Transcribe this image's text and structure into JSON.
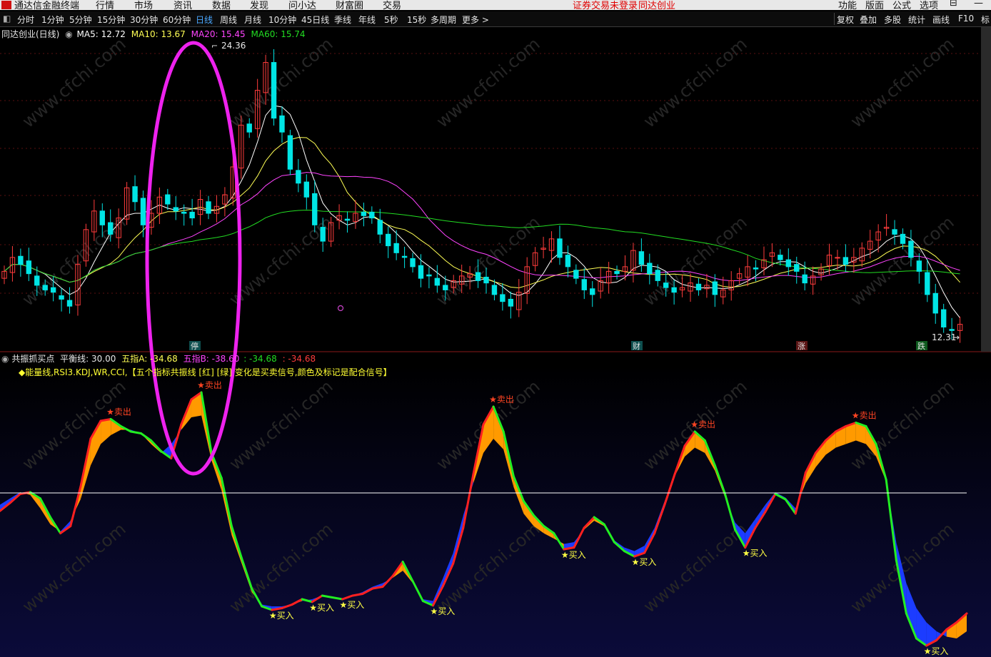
{
  "topbar": {
    "app_title": "通达信金融终端",
    "menu": [
      "行情",
      "市场",
      "资讯",
      "数据",
      "发现",
      "问小达",
      "财富圈",
      "交易"
    ],
    "warning": "证券交易未登录",
    "stock_name": "同达创业",
    "right_menu": [
      "功能",
      "版面",
      "公式",
      "选项"
    ]
  },
  "periods": [
    "分时",
    "1分钟",
    "5分钟",
    "15分钟",
    "30分钟",
    "60分钟",
    "日线",
    "周线",
    "月线",
    "10分钟",
    "45日线",
    "季线",
    "年线",
    "5秒",
    "15秒",
    "多周期",
    "更多 >"
  ],
  "active_period": "日线",
  "tools": [
    "复权",
    "叠加",
    "多股",
    "统计",
    "画线",
    "F10",
    "标"
  ],
  "main_legend": {
    "name": "同达创业(日线)",
    "ma5": "MA5: 12.72",
    "ma10": "MA10: 13.67",
    "ma20": "MA20: 15.45",
    "ma60": "MA60: 15.74"
  },
  "colors": {
    "up": "#ff3c3c",
    "down": "#00e5e5",
    "ma5": "#ffffff",
    "ma10": "#ffff55",
    "ma20": "#ff44ff",
    "ma60": "#22dd22",
    "band_up": "#ff9a00",
    "band_down": "#1c3cff",
    "highlight": "#ee22ee"
  },
  "sub_legend": {
    "name": "共振抓买点",
    "balance": "平衡线: 30.00",
    "a": "五指A: -34.68",
    "b": "五指B: -38.60",
    "c": ": -34.68",
    "d": ": -34.68",
    "desc": "◆能量线,RSI3.KDJ,WR,CCI,【五个指标共振线 [红] [绿] 变化是买卖信号,颜色及标记是配合信号】"
  },
  "chart_data": [
    {
      "type": "candlestick",
      "title": "同达创业(日线)",
      "price_max_label": "24.36",
      "price_min_label": "12.31",
      "event_labels": [
        "停",
        "财",
        "涨",
        "跌"
      ],
      "series": [
        {
          "name": "MA5",
          "value": 12.72
        },
        {
          "name": "MA10",
          "value": 13.67
        },
        {
          "name": "MA20",
          "value": 15.45
        },
        {
          "name": "MA60",
          "value": 15.74
        }
      ],
      "closes": [
        15.0,
        15.6,
        15.3,
        14.9,
        14.4,
        14.2,
        14.1,
        13.8,
        13.5,
        15.3,
        16.8,
        17.6,
        17.0,
        16.6,
        17.3,
        18.6,
        18.0,
        17.0,
        17.5,
        18.2,
        17.9,
        17.6,
        17.5,
        17.3,
        18.1,
        17.5,
        17.8,
        18.3,
        19.5,
        21.3,
        21.0,
        22.8,
        24.0,
        21.6,
        21.0,
        19.4,
        18.8,
        18.2,
        17.0,
        16.3,
        17.1,
        17.4,
        17.2,
        17.5,
        17.4,
        17.3,
        16.6,
        16.1,
        15.8,
        15.6,
        15.2,
        14.7,
        14.8,
        14.4,
        14.2,
        14.6,
        14.8,
        14.9,
        14.6,
        14.5,
        14.0,
        13.7,
        13.5,
        14.1,
        15.2,
        15.8,
        16.0,
        16.4,
        15.6,
        15.2,
        14.7,
        14.2,
        14.0,
        14.6,
        15.0,
        14.9,
        15.2,
        15.9,
        15.3,
        14.9,
        14.6,
        14.3,
        14.1,
        14.3,
        14.5,
        14.2,
        14.4,
        14.0,
        14.2,
        14.6,
        14.9,
        15.2,
        15.1,
        15.5,
        15.8,
        15.5,
        15.2,
        15.0,
        14.5,
        14.8,
        15.1,
        15.7,
        15.6,
        15.3,
        15.6,
        16.0,
        16.3,
        16.7,
        16.9,
        16.6,
        16.2,
        15.6,
        15.0,
        14.0,
        13.2,
        12.6,
        12.45,
        12.72
      ],
      "ylim": [
        12.0,
        25.0
      ]
    },
    {
      "type": "area",
      "title": "共振抓买点",
      "balance_line": 30.0,
      "annotations_buy": "买入",
      "annotations_sell": "卖出",
      "series_a": [
        -5,
        4,
        14,
        16,
        9,
        -12,
        -30,
        -22,
        22,
        76,
        96,
        98,
        90,
        84,
        82,
        74,
        62,
        54,
        92,
        120,
        128,
        60,
        32,
        -22,
        -58,
        -92,
        -112,
        -116,
        -114,
        -110,
        -104,
        -107,
        -100,
        -102,
        -104,
        -100,
        -98,
        -92,
        -90,
        -78,
        -62,
        -84,
        -106,
        -111,
        -89,
        -64,
        -24,
        36,
        92,
        112,
        84,
        34,
        6,
        -10,
        -22,
        -30,
        -48,
        -46,
        -24,
        -12,
        -20,
        -40,
        -50,
        -56,
        -52,
        -30,
        2,
        36,
        68,
        84,
        74,
        46,
        14,
        -26,
        -46,
        -24,
        -6,
        14,
        8,
        -8,
        38,
        60,
        74,
        84,
        90,
        94,
        90,
        70,
        30,
        -60,
        -120,
        -148,
        -156,
        -150,
        -138,
        -130,
        -120
      ],
      "series_b": [
        2,
        9,
        16,
        13,
        -2,
        -20,
        -28,
        -16,
        8,
        46,
        70,
        80,
        86,
        86,
        82,
        70,
        60,
        70,
        86,
        100,
        102,
        52,
        18,
        -32,
        -64,
        -96,
        -110,
        -112,
        -112,
        -110,
        -106,
        -104,
        -100,
        -102,
        -104,
        -100,
        -96,
        -90,
        -86,
        -80,
        -72,
        -86,
        -104,
        -106,
        -80,
        -52,
        -10,
        26,
        60,
        76,
        64,
        22,
        -8,
        -22,
        -30,
        -36,
        -42,
        -40,
        -26,
        -16,
        -22,
        -38,
        -46,
        -50,
        -44,
        -24,
        6,
        34,
        56,
        66,
        60,
        40,
        10,
        -18,
        -30,
        -14,
        2,
        16,
        10,
        -2,
        26,
        44,
        58,
        66,
        70,
        74,
        70,
        56,
        28,
        -40,
        -86,
        -114,
        -130,
        -140,
        -146,
        -148,
        -140
      ],
      "ylim": [
        -160,
        140
      ]
    }
  ]
}
